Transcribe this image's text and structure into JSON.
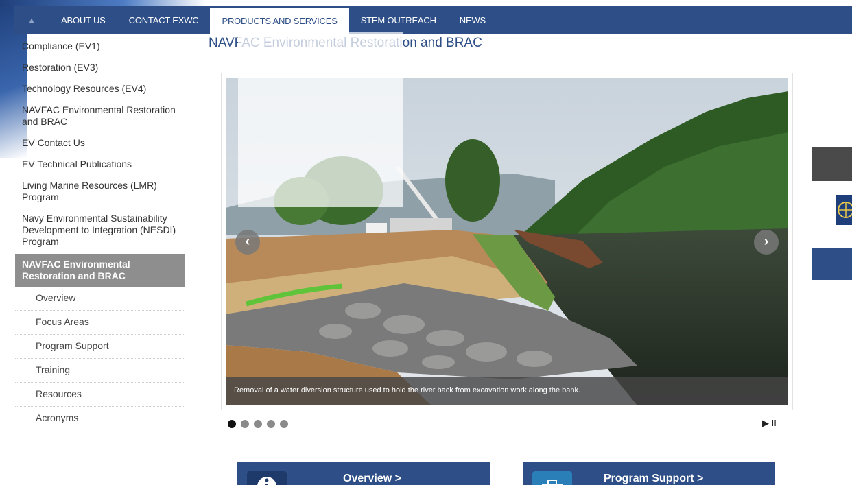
{
  "nav": {
    "home_icon": "home-icon",
    "items": [
      {
        "label": "ABOUT US"
      },
      {
        "label": "CONTACT EXWC"
      },
      {
        "label": "PRODUCTS AND SERVICES"
      },
      {
        "label": "STEM OUTREACH"
      },
      {
        "label": "NEWS"
      }
    ],
    "active_index": 2
  },
  "page": {
    "title": "NAVFAC Environmental Restoration and BRAC"
  },
  "sidebar": {
    "items": [
      {
        "label": "Compliance (EV1)"
      },
      {
        "label": "Restoration (EV3)"
      },
      {
        "label": "Technology Resources (EV4)"
      },
      {
        "label": "NAVFAC Environmental Restoration and BRAC"
      },
      {
        "label": "EV Contact Us"
      },
      {
        "label": "EV Technical Publications"
      },
      {
        "label": "Living Marine Resources (LMR) Program"
      },
      {
        "label": "Navy Environmental Sustainability Development to Integration (NESDI) Program"
      },
      {
        "label": "NAVFAC Environmental Restoration and BRAC"
      }
    ],
    "sub_items": [
      {
        "label": "Overview"
      },
      {
        "label": "Focus Areas"
      },
      {
        "label": "Program Support"
      },
      {
        "label": "Training"
      },
      {
        "label": "Resources"
      },
      {
        "label": "Acronyms"
      }
    ]
  },
  "slider": {
    "caption": "Removal of a water diversion structure used to hold the river back from excavation work along the bank.",
    "prev_icon": "chevron-left-icon",
    "next_icon": "chevron-right-icon",
    "slide_count": 5,
    "active_slide": 1,
    "controls_label": "▶ II"
  },
  "tiles": [
    {
      "label": "Overview >",
      "icon": "info-icon"
    },
    {
      "label": "Program Support >",
      "icon": "briefcase-icon"
    }
  ],
  "colors": {
    "nav_bg": "#2d4e86",
    "active_sidebar_bg": "#8e8e8e"
  }
}
